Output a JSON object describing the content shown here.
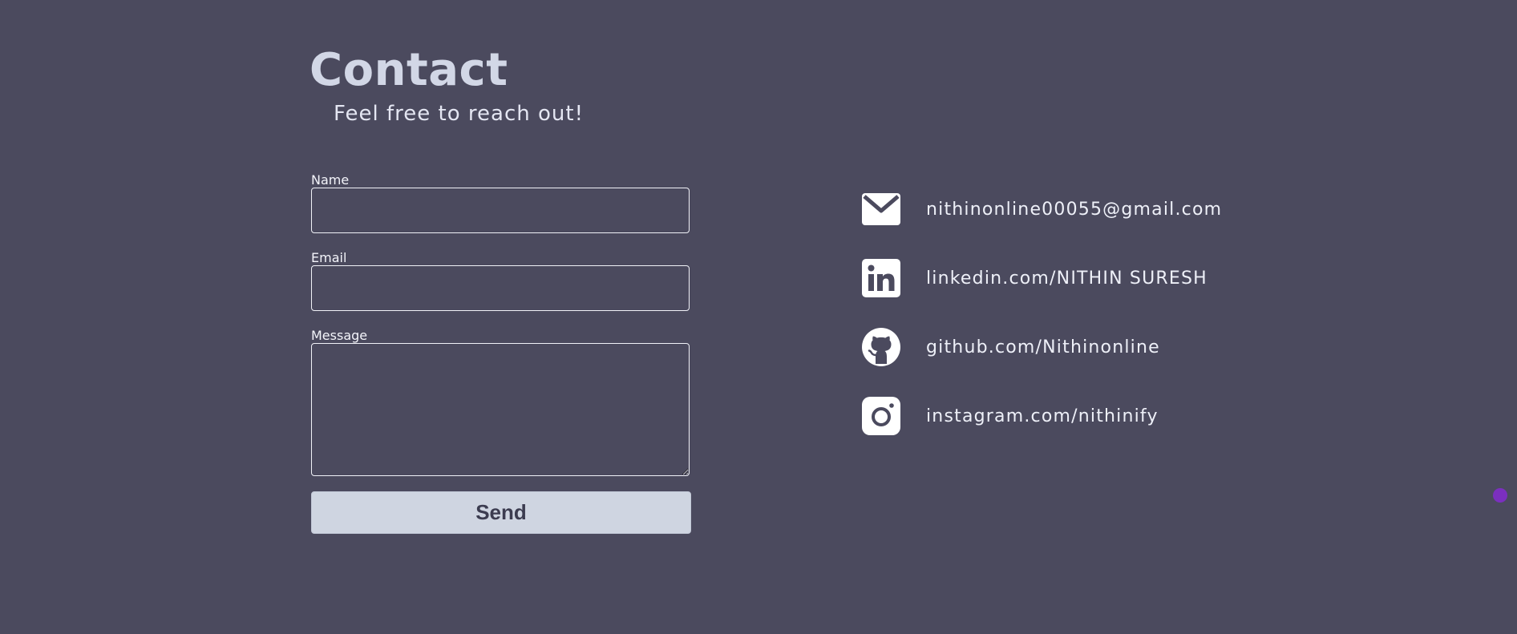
{
  "header": {
    "title": "Contact",
    "subtitle": "Feel free to reach out!"
  },
  "form": {
    "name_label": "Name",
    "name_value": "",
    "email_label": "Email",
    "email_value": "",
    "message_label": "Message",
    "message_value": "",
    "send_label": "Send"
  },
  "contacts": [
    {
      "icon": "mail-icon",
      "text": "nithinonline00055@gmail.com"
    },
    {
      "icon": "linkedin-icon",
      "text": "linkedin.com/NITHIN SURESH"
    },
    {
      "icon": "github-icon",
      "text": "github.com/Nithinonline"
    },
    {
      "icon": "instagram-icon",
      "text": "instagram.com/nithinify"
    }
  ],
  "colors": {
    "background": "#4b4a5e",
    "title": "#d2d7e6",
    "button_bg": "#cfd5e1",
    "button_text": "#3c3c50",
    "cursor_dot": "#7b2fbf"
  }
}
